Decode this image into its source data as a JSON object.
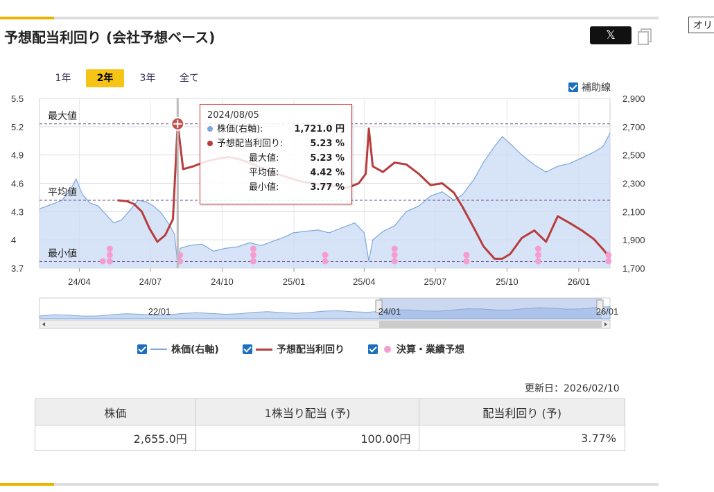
{
  "title": "予想配当利回り (会社予想ベース)",
  "x_button": "𝕏",
  "side_button": "オリ",
  "ranges": [
    "1年",
    "2年",
    "3年",
    "全て"
  ],
  "active_range": "2年",
  "aux_lines_label": "補助線",
  "legend": {
    "price": "株価(右軸)",
    "yield": "予想配当利回り",
    "events": "決算・業績予想"
  },
  "colors": {
    "price_line": "#7aa7de",
    "price_fill": "#c9d9f3",
    "yield_line": "#b83c3c",
    "event_dot": "#f59cd0",
    "accent": "#f6c417",
    "checkbox": "#1c6fbf"
  },
  "update_date": "更新日：2026/02/10",
  "table": {
    "headers": [
      "株価",
      "1株当り配当 (予)",
      "配当利回り (予)"
    ],
    "values": [
      "2,655.0円",
      "100.00円",
      "3.77%"
    ]
  },
  "tooltip": {
    "date": "2024/08/05",
    "rows": [
      {
        "label": "株価(右軸):",
        "value": "1,721.0 円",
        "dot": "#7aa7de"
      },
      {
        "label": "予想配当利回り:",
        "value": "5.23 %",
        "dot": "#b83c3c"
      },
      {
        "label": "最大値:",
        "value": "5.23 %",
        "dot": ""
      },
      {
        "label": "平均値:",
        "value": "4.42 %",
        "dot": ""
      },
      {
        "label": "最小値:",
        "value": "3.77 %",
        "dot": ""
      }
    ]
  },
  "navigator_labels": [
    "22/01",
    "24/01",
    "26/01"
  ],
  "chart_data": {
    "type": "line",
    "x_ticks": [
      "24/04",
      "24/07",
      "24/10",
      "25/01",
      "25/04",
      "25/07",
      "25/10",
      "26/01"
    ],
    "left_axis": {
      "min": 3.7,
      "max": 5.5,
      "ticks": [
        "5.5",
        "5.2",
        "4.9",
        "4.6",
        "4.3",
        "4",
        "3.7"
      ]
    },
    "right_axis": {
      "min": 1700,
      "max": 2900,
      "ticks": [
        "2,900",
        "2,700",
        "2,500",
        "2,300",
        "2,100",
        "1,900",
        "1,700"
      ]
    },
    "reference_lines": [
      {
        "label": "最大値",
        "value": 5.23
      },
      {
        "label": "平均値",
        "value": 4.42
      },
      {
        "label": "最小値",
        "value": 3.77
      }
    ],
    "x_range": [
      "2024-02-10",
      "2026-02-10"
    ],
    "series": [
      {
        "name": "株価(右軸)",
        "axis": "right",
        "points": [
          [
            "2024-02-10",
            2120
          ],
          [
            "2024-02-25",
            2150
          ],
          [
            "2024-03-10",
            2180
          ],
          [
            "2024-03-20",
            2250
          ],
          [
            "2024-03-28",
            2330
          ],
          [
            "2024-04-05",
            2220
          ],
          [
            "2024-04-15",
            2160
          ],
          [
            "2024-04-25",
            2140
          ],
          [
            "2024-05-05",
            2080
          ],
          [
            "2024-05-15",
            2020
          ],
          [
            "2024-05-25",
            2040
          ],
          [
            "2024-06-05",
            2110
          ],
          [
            "2024-06-15",
            2180
          ],
          [
            "2024-06-25",
            2170
          ],
          [
            "2024-07-05",
            2140
          ],
          [
            "2024-07-15",
            2090
          ],
          [
            "2024-07-25",
            2010
          ],
          [
            "2024-08-01",
            1940
          ],
          [
            "2024-08-05",
            1721
          ],
          [
            "2024-08-08",
            1840
          ],
          [
            "2024-08-20",
            1860
          ],
          [
            "2024-09-05",
            1870
          ],
          [
            "2024-09-20",
            1820
          ],
          [
            "2024-10-05",
            1840
          ],
          [
            "2024-10-20",
            1850
          ],
          [
            "2024-11-05",
            1880
          ],
          [
            "2024-11-20",
            1860
          ],
          [
            "2024-12-05",
            1890
          ],
          [
            "2024-12-20",
            1920
          ],
          [
            "2024-12-31",
            1950
          ],
          [
            "2025-01-15",
            1960
          ],
          [
            "2025-02-01",
            1970
          ],
          [
            "2025-02-15",
            1950
          ],
          [
            "2025-03-01",
            1980
          ],
          [
            "2025-03-20",
            2020
          ],
          [
            "2025-04-01",
            1950
          ],
          [
            "2025-04-07",
            1750
          ],
          [
            "2025-04-12",
            1900
          ],
          [
            "2025-04-25",
            1960
          ],
          [
            "2025-05-10",
            2000
          ],
          [
            "2025-05-25",
            2100
          ],
          [
            "2025-06-10",
            2140
          ],
          [
            "2025-06-25",
            2210
          ],
          [
            "2025-07-10",
            2240
          ],
          [
            "2025-07-25",
            2180
          ],
          [
            "2025-08-05",
            2220
          ],
          [
            "2025-08-20",
            2330
          ],
          [
            "2025-09-01",
            2450
          ],
          [
            "2025-09-15",
            2560
          ],
          [
            "2025-09-25",
            2630
          ],
          [
            "2025-10-05",
            2580
          ],
          [
            "2025-10-20",
            2500
          ],
          [
            "2025-11-05",
            2430
          ],
          [
            "2025-11-20",
            2380
          ],
          [
            "2025-12-05",
            2420
          ],
          [
            "2025-12-20",
            2440
          ],
          [
            "2026-01-05",
            2480
          ],
          [
            "2026-01-20",
            2520
          ],
          [
            "2026-02-01",
            2560
          ],
          [
            "2026-02-10",
            2655
          ]
        ]
      },
      {
        "name": "予想配当利回り",
        "axis": "left",
        "points": [
          [
            "2024-05-20",
            4.42
          ],
          [
            "2024-06-01",
            4.41
          ],
          [
            "2024-06-10",
            4.38
          ],
          [
            "2024-06-20",
            4.3
          ],
          [
            "2024-06-30",
            4.12
          ],
          [
            "2024-07-10",
            3.98
          ],
          [
            "2024-07-20",
            4.05
          ],
          [
            "2024-07-30",
            4.22
          ],
          [
            "2024-08-05",
            5.23
          ],
          [
            "2024-08-12",
            4.75
          ],
          [
            "2024-08-25",
            4.78
          ],
          [
            "2024-09-10",
            4.83
          ],
          [
            "2024-09-25",
            4.86
          ],
          [
            "2024-10-10",
            4.88
          ],
          [
            "2024-10-25",
            4.85
          ],
          [
            "2024-11-10",
            4.8
          ],
          [
            "2024-11-25",
            4.75
          ],
          [
            "2024-12-10",
            4.7
          ],
          [
            "2024-12-25",
            4.66
          ],
          [
            "2025-01-10",
            4.62
          ],
          [
            "2025-01-25",
            4.6
          ],
          [
            "2025-02-10",
            4.58
          ],
          [
            "2025-02-25",
            4.57
          ],
          [
            "2025-03-10",
            4.55
          ],
          [
            "2025-03-25",
            4.6
          ],
          [
            "2025-04-03",
            4.7
          ],
          [
            "2025-04-07",
            5.18
          ],
          [
            "2025-04-12",
            4.78
          ],
          [
            "2025-04-25",
            4.72
          ],
          [
            "2025-05-10",
            4.82
          ],
          [
            "2025-05-25",
            4.8
          ],
          [
            "2025-06-10",
            4.7
          ],
          [
            "2025-06-25",
            4.58
          ],
          [
            "2025-07-10",
            4.6
          ],
          [
            "2025-07-25",
            4.5
          ],
          [
            "2025-08-05",
            4.35
          ],
          [
            "2025-08-20",
            4.12
          ],
          [
            "2025-09-01",
            3.93
          ],
          [
            "2025-09-15",
            3.8
          ],
          [
            "2025-09-25",
            3.8
          ],
          [
            "2025-10-05",
            3.85
          ],
          [
            "2025-10-20",
            4.02
          ],
          [
            "2025-11-05",
            4.1
          ],
          [
            "2025-11-20",
            3.98
          ],
          [
            "2025-12-05",
            4.25
          ],
          [
            "2025-12-20",
            4.18
          ],
          [
            "2026-01-05",
            4.1
          ],
          [
            "2026-01-20",
            4.01
          ],
          [
            "2026-02-01",
            3.9
          ],
          [
            "2026-02-10",
            3.81
          ]
        ]
      }
    ],
    "events": [
      {
        "date": "2024-05-10",
        "count": 3
      },
      {
        "date": "2024-05-01",
        "count": 1
      },
      {
        "date": "2024-08-08",
        "count": 2
      },
      {
        "date": "2024-11-10",
        "count": 3
      },
      {
        "date": "2025-02-10",
        "count": 2
      },
      {
        "date": "2025-05-10",
        "count": 3
      },
      {
        "date": "2025-08-10",
        "count": 2
      },
      {
        "date": "2025-11-10",
        "count": 3
      },
      {
        "date": "2026-02-08",
        "count": 2
      }
    ]
  }
}
